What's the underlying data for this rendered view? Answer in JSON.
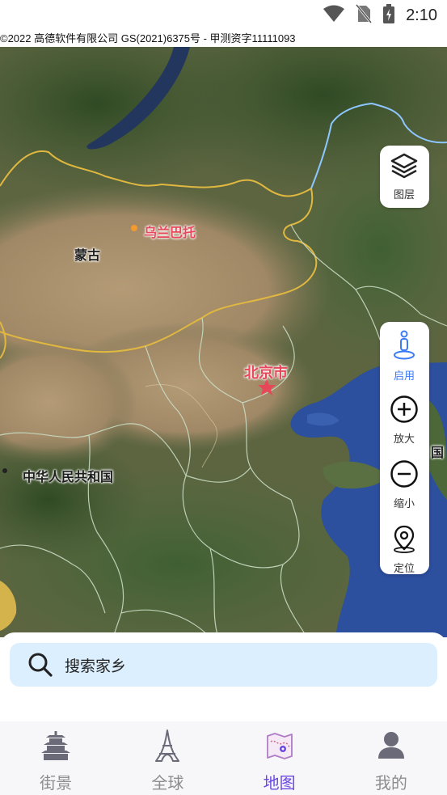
{
  "status_bar": {
    "time": "2:10",
    "icons": [
      "wifi-icon",
      "no-sim-icon",
      "battery-charging-icon"
    ]
  },
  "map": {
    "copyright": "©2022 高德软件有限公司 GS(2021)6375号 - 甲测资字11111093",
    "labels": {
      "ulaanbaatar": "乌兰巴托",
      "mongolia": "蒙古",
      "beijing": "北京市",
      "china": "中华人民共和国",
      "edge": "国"
    },
    "colors": {
      "land": "#59623f",
      "desert": "#a58d6a",
      "sea": "#2c4f9e",
      "border": "#e0b840",
      "province": "#c8d8c8"
    }
  },
  "controls": {
    "layers": {
      "label": "图层",
      "icon": "layers-icon"
    },
    "street_view": {
      "label": "启用",
      "icon": "pegman-icon"
    },
    "zoom_in": {
      "label": "放大",
      "icon": "plus-circle-icon"
    },
    "zoom_out": {
      "label": "缩小",
      "icon": "minus-circle-icon"
    },
    "locate": {
      "label": "定位",
      "icon": "location-pin-icon"
    },
    "accent": "#3b7cf5"
  },
  "search": {
    "placeholder": "搜索家乡",
    "icon": "search-icon"
  },
  "tabs": [
    {
      "label": "街景",
      "icon": "pagoda-icon",
      "active": false
    },
    {
      "label": "全球",
      "icon": "eiffel-tower-icon",
      "active": false
    },
    {
      "label": "地图",
      "icon": "map-icon",
      "active": true
    },
    {
      "label": "我的",
      "icon": "user-icon",
      "active": false
    }
  ],
  "tab_active_color": "#6b48e0"
}
